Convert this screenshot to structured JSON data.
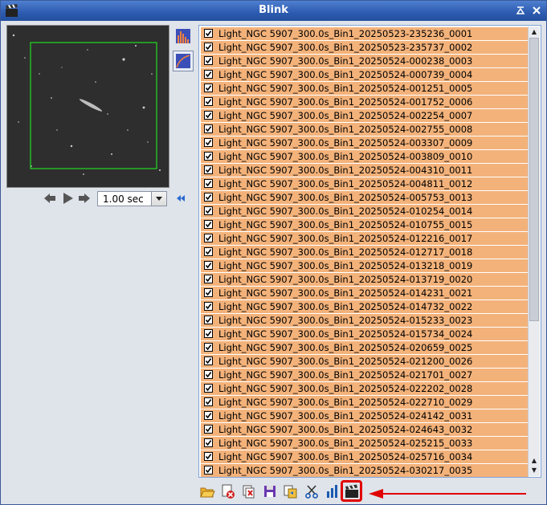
{
  "window": {
    "title": "Blink"
  },
  "player": {
    "interval_value": "1.00 sec"
  },
  "files": [
    "Light_NGC 5907_300.0s_Bin1_20250523-235236_0001",
    "Light_NGC 5907_300.0s_Bin1_20250523-235737_0002",
    "Light_NGC 5907_300.0s_Bin1_20250524-000238_0003",
    "Light_NGC 5907_300.0s_Bin1_20250524-000739_0004",
    "Light_NGC 5907_300.0s_Bin1_20250524-001251_0005",
    "Light_NGC 5907_300.0s_Bin1_20250524-001752_0006",
    "Light_NGC 5907_300.0s_Bin1_20250524-002254_0007",
    "Light_NGC 5907_300.0s_Bin1_20250524-002755_0008",
    "Light_NGC 5907_300.0s_Bin1_20250524-003307_0009",
    "Light_NGC 5907_300.0s_Bin1_20250524-003809_0010",
    "Light_NGC 5907_300.0s_Bin1_20250524-004310_0011",
    "Light_NGC 5907_300.0s_Bin1_20250524-004811_0012",
    "Light_NGC 5907_300.0s_Bin1_20250524-005753_0013",
    "Light_NGC 5907_300.0s_Bin1_20250524-010254_0014",
    "Light_NGC 5907_300.0s_Bin1_20250524-010755_0015",
    "Light_NGC 5907_300.0s_Bin1_20250524-012216_0017",
    "Light_NGC 5907_300.0s_Bin1_20250524-012717_0018",
    "Light_NGC 5907_300.0s_Bin1_20250524-013218_0019",
    "Light_NGC 5907_300.0s_Bin1_20250524-013719_0020",
    "Light_NGC 5907_300.0s_Bin1_20250524-014231_0021",
    "Light_NGC 5907_300.0s_Bin1_20250524-014732_0022",
    "Light_NGC 5907_300.0s_Bin1_20250524-015233_0023",
    "Light_NGC 5907_300.0s_Bin1_20250524-015734_0024",
    "Light_NGC 5907_300.0s_Bin1_20250524-020659_0025",
    "Light_NGC 5907_300.0s_Bin1_20250524-021200_0026",
    "Light_NGC 5907_300.0s_Bin1_20250524-021701_0027",
    "Light_NGC 5907_300.0s_Bin1_20250524-022202_0028",
    "Light_NGC 5907_300.0s_Bin1_20250524-022710_0029",
    "Light_NGC 5907_300.0s_Bin1_20250524-024142_0031",
    "Light_NGC 5907_300.0s_Bin1_20250524-024643_0032",
    "Light_NGC 5907_300.0s_Bin1_20250524-025215_0033",
    "Light_NGC 5907_300.0s_Bin1_20250524-025716_0034",
    "Light_NGC 5907_300.0s_Bin1_20250524-030217_0035"
  ],
  "all_checked": true,
  "colors": {
    "row_fill": "#f3b27a",
    "title_bar": "#2c5bb0",
    "highlight": "#e00000"
  },
  "toolbar_icons": [
    "folder-open-icon",
    "close-selected-icon",
    "close-all-icon",
    "save-icon",
    "copy-to-icon",
    "crop-icon",
    "statistics-icon",
    "create-movie-icon"
  ]
}
